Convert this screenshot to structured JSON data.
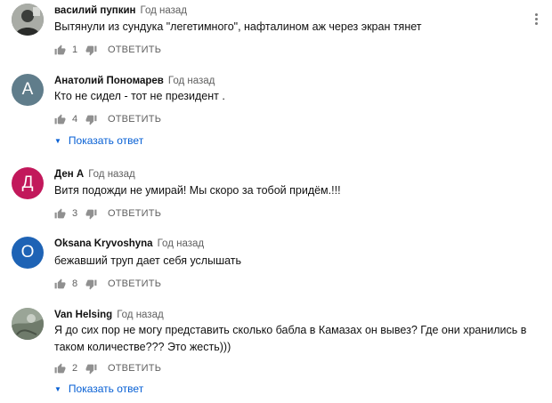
{
  "colors": {
    "author_color": "#111111",
    "meta_color": "#606060",
    "link_color": "#065fd4",
    "icon_color": "#909090",
    "avatar_anatoly": "#607d8b",
    "avatar_den": "#c2185b",
    "avatar_oksana": "#1e63b5"
  },
  "comments": [
    {
      "author": "василий пупкин",
      "time": "Год назад",
      "text_lines": [
        "Вытянули из сундука \"легетимного\", нафталином аж через экран тянет"
      ],
      "likes": "1",
      "reply_label": "ОТВЕТИТЬ",
      "avatar_type": "photo"
    },
    {
      "author": "Анатолий Пономарев",
      "time": "Год назад",
      "text_lines": [
        "Кто не сидел - тот не президент  ."
      ],
      "likes": "4",
      "reply_label": "ОТВЕТИТЬ",
      "avatar_letter": "А",
      "show_replies": "Показать ответ"
    },
    {
      "author": "Ден А",
      "time": "Год назад",
      "text_lines": [
        "Витя подожди не умирай! Мы скоро за тобой придём.!!!"
      ],
      "likes": "3",
      "reply_label": "ОТВЕТИТЬ",
      "avatar_letter": "Д"
    },
    {
      "author": "Oksana Kryvoshyna",
      "time": "Год назад",
      "text_lines": [
        "бежавший труп дает себя услышать"
      ],
      "likes": "8",
      "reply_label": "ОТВЕТИТЬ",
      "avatar_letter": "О"
    },
    {
      "author": "Van Helsing",
      "time": "Год назад",
      "text_lines": [
        "Я до сих пор не могу представить сколько бабла в Камазах он вывез? Где они хранились в",
        "таком количестве??? Это жесть)))"
      ],
      "likes": "2",
      "reply_label": "ОТВЕТИТЬ",
      "avatar_type": "photo",
      "show_replies": "Показать ответ"
    }
  ],
  "icons": {
    "like": "thumbs-up-icon",
    "dislike": "thumbs-down-icon",
    "menu": "more-vert-icon",
    "expand": "caret-down-icon"
  }
}
